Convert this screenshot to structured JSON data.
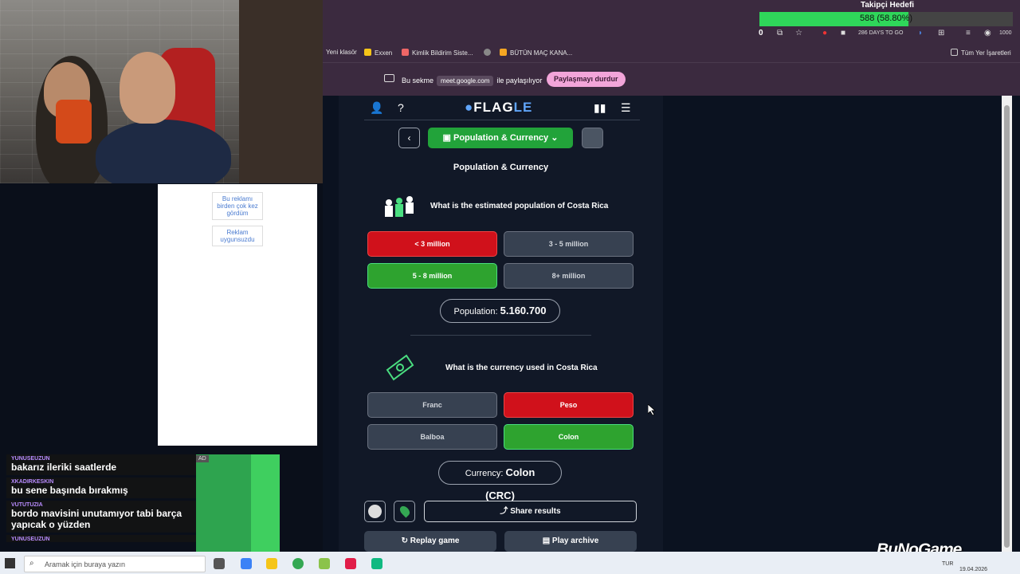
{
  "ad": {
    "button1": "Bu reklamı birden çok kez gördüm",
    "button2": "Reklam uygunsuzdu",
    "tag": "AD"
  },
  "chat": [
    {
      "user": "YUNUSEUZUN",
      "text": "bakarız ileriki saatlerde"
    },
    {
      "user": "XKADIRKESKIN",
      "text": "bu sene başında bırakmış"
    },
    {
      "user": "VUTUTUZIA",
      "text": "bordo mavisini unutamıyor tabi barça yapıcak o yüzden"
    },
    {
      "user": "YUNUSEUZUN",
      "text": ""
    }
  ],
  "follower": {
    "title": "Takipçi Hedefi",
    "text": "588 (58.80%)",
    "progress": 0.588
  },
  "toolbar": {
    "count": "0",
    "days_label": "286 DAYS TO GO",
    "points": "1000"
  },
  "bookmarks": [
    {
      "label": "Yeni klasör",
      "color": "#3b2a3f"
    },
    {
      "label": "Exxen",
      "color": "#f5c518"
    },
    {
      "label": "Kimlik Bildirim Siste...",
      "color": "#e66"
    },
    {
      "label": "",
      "color": "#888"
    },
    {
      "label": "BÜTÜN MAÇ KANA...",
      "color": "#f5a623"
    }
  ],
  "all_bookmarks": "Tüm Yer İşaretleri",
  "share_bar": {
    "prefix": "Bu sekme",
    "domain": "meet.google.com",
    "suffix": "ile paylaşılıyor",
    "stop": "Paylaşmayı durdur"
  },
  "game": {
    "logo_main": "FLAG",
    "logo_accent": "LE",
    "mode": "Population & Currency",
    "section_title": "Population & Currency",
    "q1": {
      "question": "What is the estimated population of Costa Rica",
      "answers": [
        "< 3 million",
        "3 - 5 million",
        "5 - 8 million",
        "8+ million"
      ],
      "result_label": "Population:",
      "result_value": "5.160.700"
    },
    "q2": {
      "question": "What is the currency used in Costa Rica",
      "answers": [
        "Franc",
        "Peso",
        "Balboa",
        "Colon"
      ],
      "result_label": "Currency:",
      "result_value": "Colon (CRC)"
    },
    "share": "Share results",
    "replay": "Replay game",
    "archive": "Play archive"
  },
  "taskbar": {
    "search_placeholder": "Aramak için buraya yazın",
    "lang": "TUR",
    "date": "19.04.2026"
  },
  "watermark": "BuNoGame",
  "colors": {
    "wrong": "#d0111b",
    "correct": "#2ea32f",
    "mode": "#22a33a",
    "bar": "#2fd65a"
  }
}
